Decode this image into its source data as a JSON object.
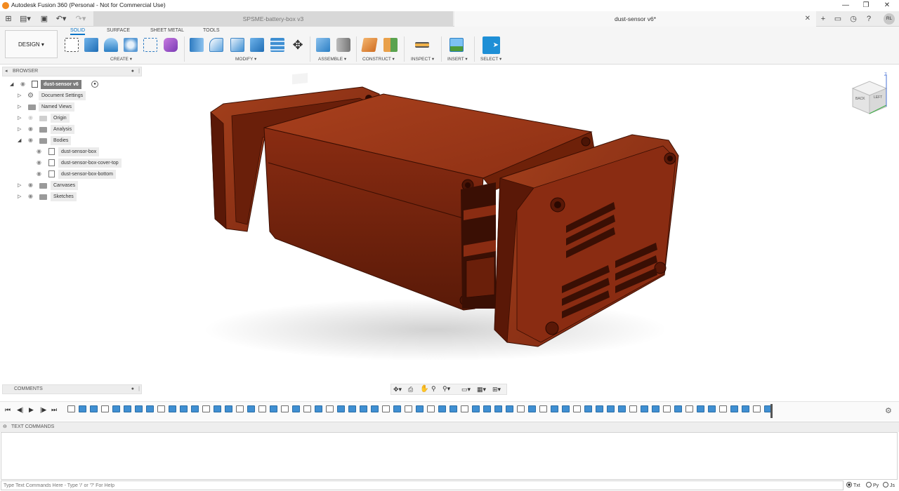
{
  "app": {
    "title": "Autodesk Fusion 360 (Personal - Not for Commercial Use)",
    "user_initials": "RL"
  },
  "tabs": [
    {
      "label": "SPSME-battery-box v3",
      "active": false
    },
    {
      "label": "dust-sensor v6*",
      "active": true
    }
  ],
  "toolbar": {
    "design_label": "DESIGN ▾",
    "workspace_tabs": [
      "SOLID",
      "SURFACE",
      "SHEET METAL",
      "TOOLS"
    ],
    "groups": [
      "CREATE ▾",
      "MODIFY ▾",
      "ASSEMBLE ▾",
      "CONSTRUCT ▾",
      "INSPECT ▾",
      "INSERT ▾",
      "SELECT ▾"
    ]
  },
  "browser": {
    "header": "BROWSER",
    "root": "dust-sensor v6",
    "items": [
      "Document Settings",
      "Named Views",
      "Origin",
      "Analysis",
      "Bodies"
    ],
    "bodies": [
      "dust-sensor-box",
      "dust-sensor-box-cover-top",
      "dust-sensor-box-bottom"
    ],
    "more": [
      "Canvases",
      "Sketches"
    ]
  },
  "comments": {
    "header": "COMMENTS"
  },
  "viewcube": {
    "face_back": "BACK",
    "face_left": "LEFT"
  },
  "text_commands": {
    "header": "TEXT COMMANDS",
    "placeholder": "Type Text Commands Here - Type '/' or '?' For Help",
    "modes": [
      "Txt",
      "Py",
      "Js"
    ]
  },
  "colors": {
    "model": "#8a2a10",
    "accent": "#0a74c7",
    "timeline_feature": "#3f8fd2"
  },
  "icons": [
    "grid-icon",
    "file-icon",
    "save-icon",
    "undo-icon",
    "redo-icon",
    "plus-icon",
    "notification-icon",
    "clock-icon",
    "help-icon"
  ]
}
